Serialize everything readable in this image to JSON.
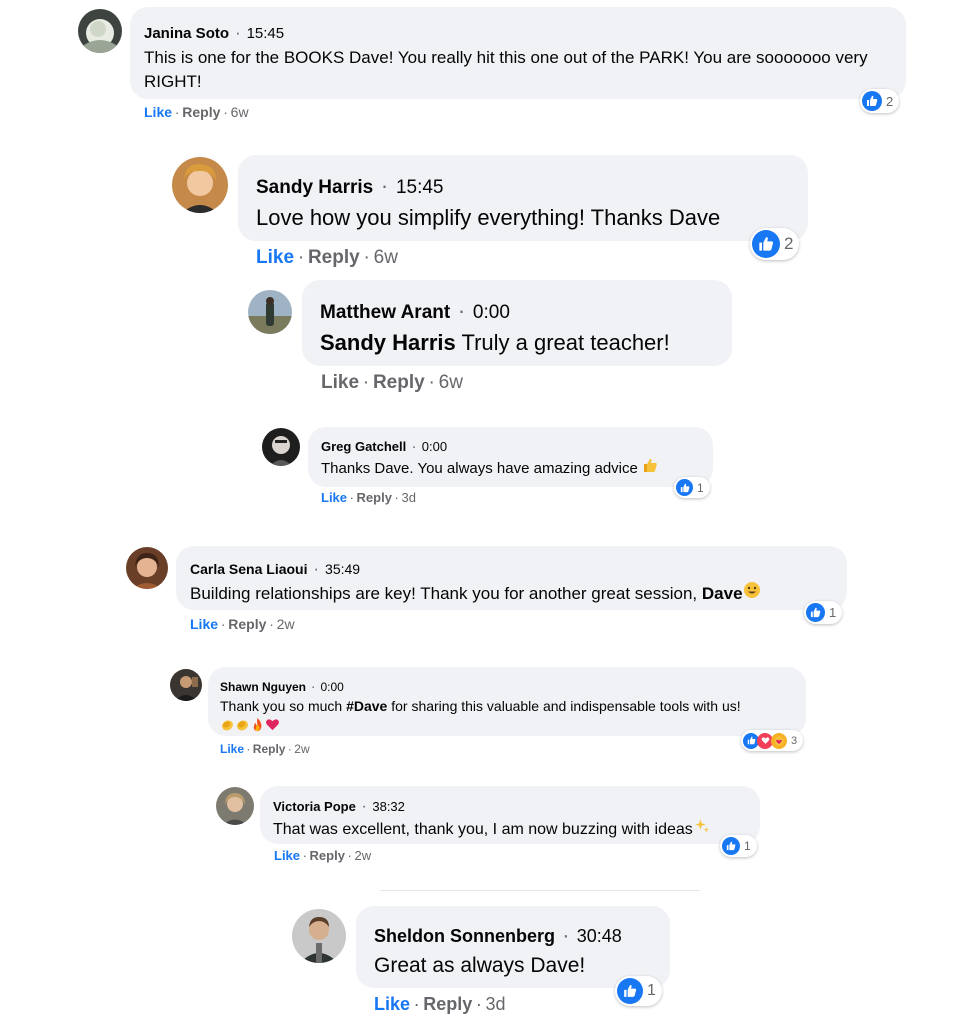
{
  "comments": [
    {
      "author": "Janina Soto",
      "time": "15:45",
      "text": "This is one for the BOOKS Dave! You really hit this one out of the PARK! You are sooooooo very RIGHT!",
      "like_label": "Like",
      "reply_label": "Reply",
      "age": "6w",
      "reaction_count": "2"
    },
    {
      "author": "Sandy Harris",
      "time": "15:45",
      "text": "Love how you simplify everything! Thanks Dave",
      "like_label": "Like",
      "reply_label": "Reply",
      "age": "6w",
      "reaction_count": "2"
    },
    {
      "author": "Matthew Arant",
      "time": "0:00",
      "mention": "Sandy Harris",
      "text": "Truly a great teacher!",
      "like_label": "Like",
      "reply_label": "Reply",
      "age": "6w"
    },
    {
      "author": "Greg Gatchell",
      "time": "0:00",
      "text": "Thanks Dave. You always have amazing advice",
      "like_label": "Like",
      "reply_label": "Reply",
      "age": "3d",
      "reaction_count": "1"
    },
    {
      "author": "Carla Sena Liaoui",
      "time": "35:49",
      "text": "Building relationships are key! Thank you for another great session,",
      "mention": "Dave",
      "like_label": "Like",
      "reply_label": "Reply",
      "age": "2w",
      "reaction_count": "1"
    },
    {
      "author": "Shawn Nguyen",
      "time": "0:00",
      "text_before": "Thank you so much",
      "mention": "#Dave",
      "text_after": "for sharing this valuable and indispensable tools with us!",
      "like_label": "Like",
      "reply_label": "Reply",
      "age": "2w",
      "reaction_count": "3"
    },
    {
      "author": "Victoria Pope",
      "time": "38:32",
      "text": "That was excellent, thank you, I am now buzzing with ideas",
      "like_label": "Like",
      "reply_label": "Reply",
      "age": "2w",
      "reaction_count": "1"
    },
    {
      "author": "Sheldon Sonnenberg",
      "time": "30:48",
      "text": "Great as always Dave!",
      "like_label": "Like",
      "reply_label": "Reply",
      "age": "3d",
      "reaction_count": "1"
    }
  ],
  "separator": "·",
  "colors": {
    "bubble": "#f0f2f5",
    "like_blue": "#1877f2",
    "meta_gray": "#65676b",
    "text": "#050505"
  },
  "icons": [
    "like-icon",
    "love-icon",
    "care-icon",
    "clap-emoji",
    "fire-emoji",
    "heart-emoji",
    "thumbs-up-emoji",
    "smile-emoji",
    "sparkles-emoji"
  ]
}
